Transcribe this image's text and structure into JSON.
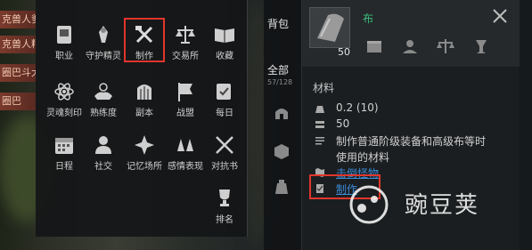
{
  "quests": [
    "克兽人爹",
    "克兽人精",
    "圈巴斗大",
    "圈巴"
  ],
  "menu": {
    "items": [
      {
        "label": "职业",
        "icon": "class-book-icon"
      },
      {
        "label": "守护精灵",
        "icon": "guardian-spirit-icon"
      },
      {
        "label": "制作",
        "icon": "hammer-wrench-icon",
        "highlighted": true
      },
      {
        "label": "交易所",
        "icon": "scales-icon"
      },
      {
        "label": "收藏",
        "icon": "open-book-icon"
      },
      {
        "label": "灵魂刻印",
        "icon": "soul-atom-icon"
      },
      {
        "label": "熟练度",
        "icon": "proficiency-hands-icon"
      },
      {
        "label": "副本",
        "icon": "gate-icon"
      },
      {
        "label": "战盟",
        "icon": "guild-banner-icon"
      },
      {
        "label": "每日",
        "icon": "daily-check-icon"
      },
      {
        "label": "日程",
        "icon": "calendar-icon"
      },
      {
        "label": "社交",
        "icon": "social-person-icon"
      },
      {
        "label": "记忆场所",
        "icon": "memory-place-icon"
      },
      {
        "label": "感情表现",
        "icon": "emotion-hands-icon"
      },
      {
        "label": "对抗书",
        "icon": "crossed-swords-icon"
      },
      {
        "label": "排名",
        "icon": "trophy-icon"
      }
    ]
  },
  "side": {
    "tab_bag": "背包",
    "tab_all": "全部",
    "count": "57/128"
  },
  "tooltip": {
    "item_name": "布",
    "quantity": "50",
    "category": "材料",
    "weight": "0.2 (10)",
    "stack": "50",
    "description_line1": "制作普通阶级装备和高级布等时",
    "description_line2": "使用的材料",
    "source_link": "击倒怪物",
    "craft_link": "制作"
  },
  "watermark": "豌豆荚",
  "colors": {
    "highlight": "#e0362c",
    "item_name": "#3bbd7d",
    "link": "#3a8ad6"
  }
}
